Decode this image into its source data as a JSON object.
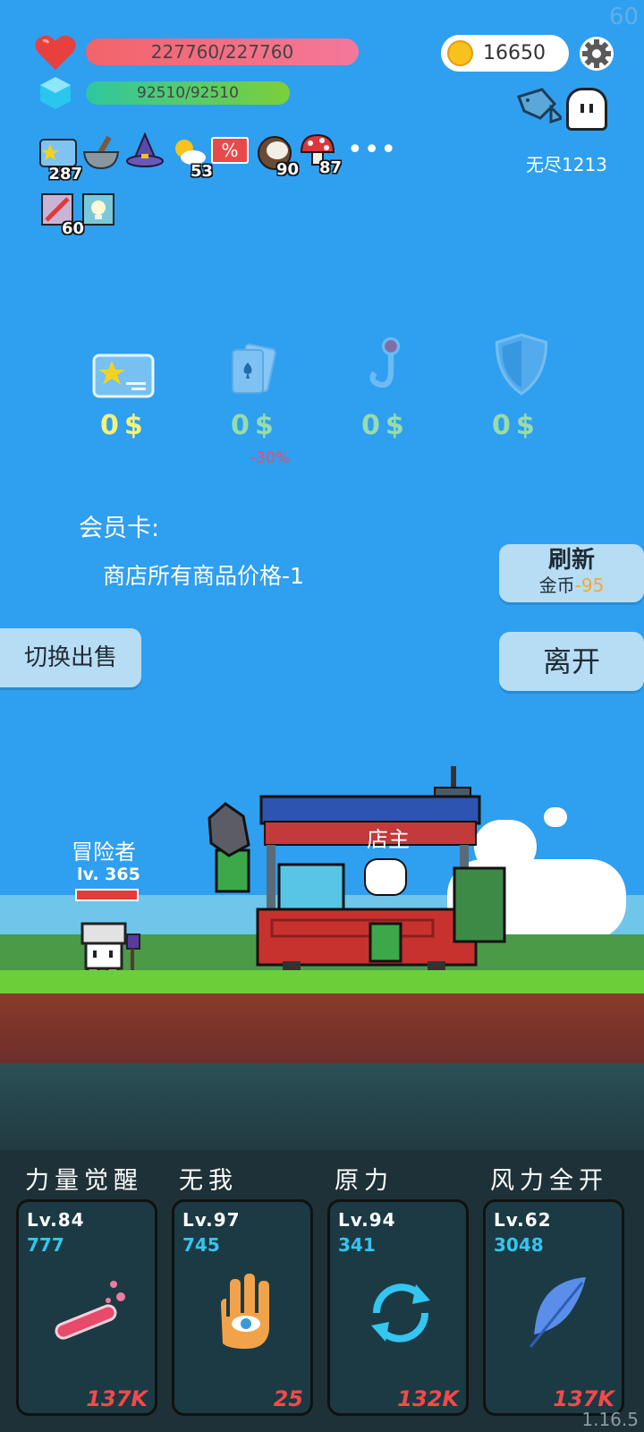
{
  "status": {
    "hp": "227760/227760",
    "mp": "92510/92510",
    "coins": "16650",
    "endless": "无尽1213"
  },
  "buffs": [
    {
      "icon": "star-card-icon",
      "count": "287"
    },
    {
      "icon": "mortar-icon",
      "count": ""
    },
    {
      "icon": "wizard-hat-icon",
      "count": ""
    },
    {
      "icon": "sun-cloud-icon",
      "count": "53"
    },
    {
      "icon": "percent-tag-icon",
      "count": ""
    },
    {
      "icon": "coconut-icon",
      "count": "90"
    },
    {
      "icon": "mushroom-icon",
      "count": "87"
    },
    {
      "icon": "sword-scroll-icon",
      "count": "60"
    },
    {
      "icon": "lightbulb-icon",
      "count": ""
    }
  ],
  "shop": {
    "items": [
      {
        "icon": "member-card-icon",
        "price": "0$",
        "discount": ""
      },
      {
        "icon": "playing-cards-icon",
        "price": "0$",
        "discount": "-30%"
      },
      {
        "icon": "hook-icon",
        "price": "0$",
        "discount": ""
      },
      {
        "icon": "shield-icon",
        "price": "0$",
        "discount": ""
      }
    ],
    "member_title": "会员卡:",
    "member_desc": "商店所有商品价格-1",
    "refresh_label": "刷新",
    "refresh_cost_label": "金币",
    "refresh_cost": "-95",
    "leave_label": "离开",
    "switch_label": "切换出售"
  },
  "scene": {
    "adventurer_name": "冒险者",
    "adventurer_level": "lv. 365",
    "shopkeeper_label": "店主"
  },
  "skills": [
    {
      "name": "力量觉醒",
      "level": "Lv.84",
      "count": "777",
      "cost": "137K",
      "icon": "potion-tube-icon"
    },
    {
      "name": "无我",
      "level": "Lv.97",
      "count": "745",
      "cost": "25",
      "icon": "eye-hand-icon"
    },
    {
      "name": "原力",
      "level": "Lv.94",
      "count": "341",
      "cost": "132K",
      "icon": "cycle-arrows-icon"
    },
    {
      "name": "风力全开",
      "level": "Lv.62",
      "count": "3048",
      "cost": "137K",
      "icon": "feather-icon"
    }
  ],
  "fps": "60",
  "version": "1.16.5",
  "colors": {
    "sky": "#2f9ff0",
    "grass": "#6ccf3a",
    "dirt": "#8a3a2a",
    "panel": "#1f3138",
    "accent_cost": "#f34a4a"
  }
}
